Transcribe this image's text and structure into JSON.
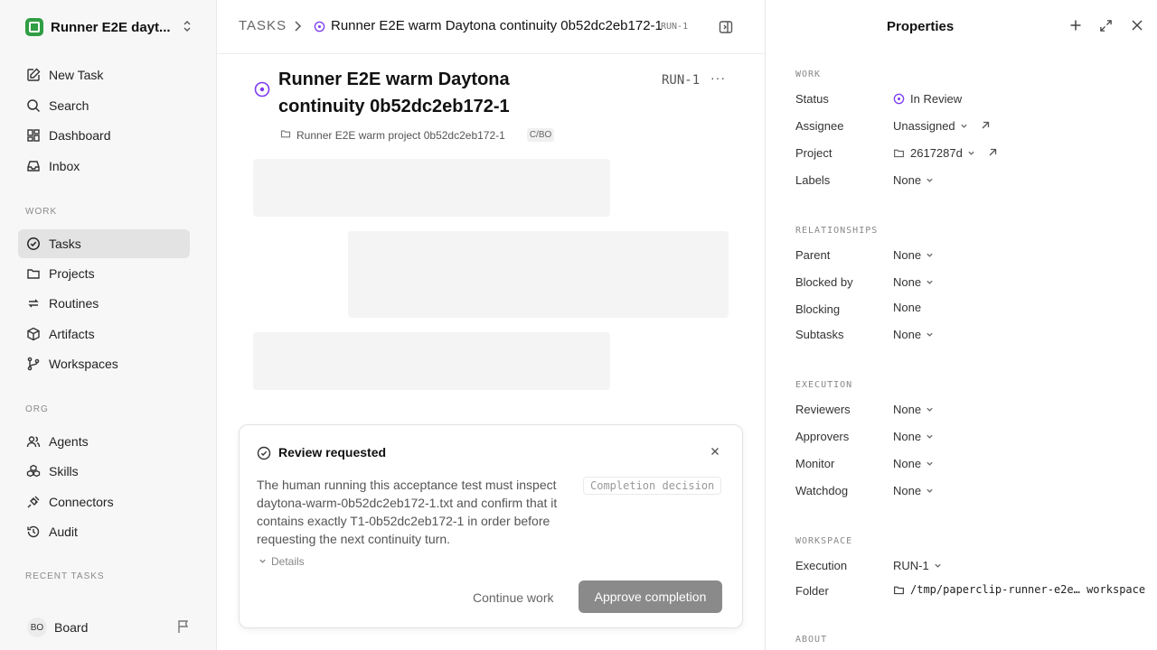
{
  "sidebar": {
    "workspace_name": "Runner E2E dayt...",
    "nav_primary": [
      {
        "label": "New Task",
        "icon": "edit-icon"
      },
      {
        "label": "Search",
        "icon": "search-icon"
      },
      {
        "label": "Dashboard",
        "icon": "dashboard-icon"
      },
      {
        "label": "Inbox",
        "icon": "inbox-icon"
      }
    ],
    "section_work": "WORK",
    "nav_work": [
      {
        "label": "Tasks",
        "icon": "check-circle-icon",
        "active": true
      },
      {
        "label": "Projects",
        "icon": "folder-icon"
      },
      {
        "label": "Routines",
        "icon": "repeat-icon"
      },
      {
        "label": "Artifacts",
        "icon": "box-icon"
      },
      {
        "label": "Workspaces",
        "icon": "branch-icon"
      }
    ],
    "section_org": "ORG",
    "nav_org": [
      {
        "label": "Agents",
        "icon": "users-icon"
      },
      {
        "label": "Skills",
        "icon": "boxes-icon"
      },
      {
        "label": "Connectors",
        "icon": "plug-icon"
      },
      {
        "label": "Audit",
        "icon": "history-icon"
      }
    ],
    "section_recent": "RECENT TASKS",
    "board": {
      "initials": "BO",
      "label": "Board"
    }
  },
  "topbar": {
    "crumb_root": "TASKS",
    "crumb_title": "Runner E2E warm Daytona continuity 0b52dc2eb172-1",
    "crumb_id": "RUN-1"
  },
  "task": {
    "title": "Runner E2E warm Daytona continuity 0b52dc2eb172-1",
    "id": "RUN-1",
    "more": "···",
    "project": "Runner E2E warm project 0b52dc2eb172-1",
    "badge": "C/BO"
  },
  "review": {
    "title": "Review requested",
    "body": "The human running this acceptance test must inspect daytona-warm-0b52dc2eb172-1.txt and confirm that it contains exactly T1-0b52dc2eb172-1 in order before requesting the next continuity turn.",
    "decision_tag": "Completion decision",
    "details": "Details",
    "continue_label": "Continue work",
    "approve_label": "Approve completion"
  },
  "properties": {
    "title": "Properties",
    "work_section": "WORK",
    "status_label": "Status",
    "status_value": "In Review",
    "status_color": "#7c3aed",
    "assignee_label": "Assignee",
    "assignee_value": "Unassigned",
    "project_label": "Project",
    "project_value": "2617287d",
    "labels_label": "Labels",
    "labels_value": "None",
    "relationships_section": "RELATIONSHIPS",
    "parent_label": "Parent",
    "parent_value": "None",
    "blocked_by_label": "Blocked by",
    "blocked_by_value": "None",
    "blocking_label": "Blocking",
    "blocking_value": "None",
    "subtasks_label": "Subtasks",
    "subtasks_value": "None",
    "execution_section": "EXECUTION",
    "reviewers_label": "Reviewers",
    "reviewers_value": "None",
    "approvers_label": "Approvers",
    "approvers_value": "None",
    "monitor_label": "Monitor",
    "monitor_value": "None",
    "watchdog_label": "Watchdog",
    "watchdog_value": "None",
    "workspace_section": "WORKSPACE",
    "execution_label": "Execution",
    "execution_value": "RUN-1",
    "folder_label": "Folder",
    "folder_value": "/tmp/paperclip-runner-e2e… workspace",
    "about_section": "ABOUT"
  }
}
